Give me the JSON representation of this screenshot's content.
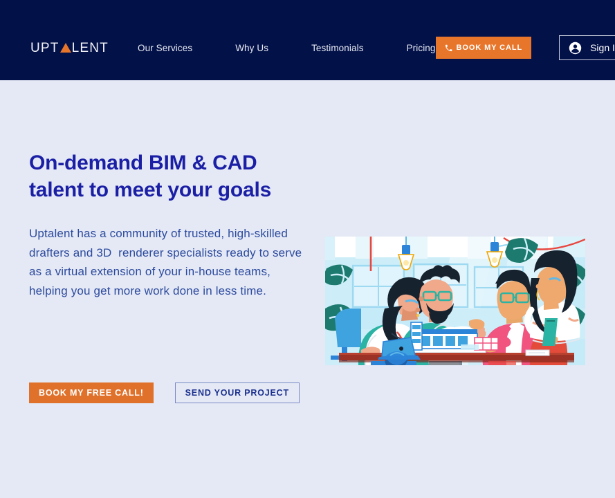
{
  "brand": {
    "logo_part1": "UPT",
    "logo_triangle_icon": "triangle-icon",
    "logo_part2": "LENT",
    "accent_orange": "#e8762a",
    "navy": "#031149",
    "page_bg": "#e4e9f5",
    "heading_blue": "#1b1fa5"
  },
  "nav": {
    "links": [
      {
        "label": "Our Services"
      },
      {
        "label": "Why Us"
      },
      {
        "label": "Testimonials"
      },
      {
        "label": "Pricing"
      }
    ],
    "book_call_label": "BOOK MY CALL",
    "book_call_icon": "phone-icon",
    "signin_label": "Sign In",
    "signin_icon": "user-avatar-icon"
  },
  "hero": {
    "title": "On-demand BIM & CAD talent to meet your goals",
    "paragraph": "Uptalent has a community of trusted, high-skilled drafters and 3D  renderer specialists ready to serve as a virtual extension of your in-house teams, helping you get more work done in less time.",
    "cta_primary": "BOOK MY FREE CALL!",
    "cta_secondary": "SEND YOUR PROJECT",
    "illustration_alt": "office-team-meeting-illustration"
  }
}
